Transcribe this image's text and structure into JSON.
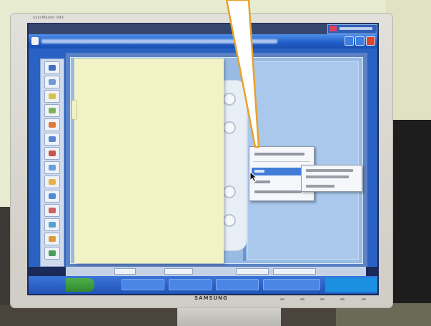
{
  "monitor": {
    "brand": "SAMSUNG",
    "model": "SyncMaster 943"
  },
  "window": {
    "controls": [
      "minimize-icon",
      "maximize-icon",
      "close-icon"
    ]
  },
  "toolbar": {
    "icons": [
      "tool-icon",
      "tool-icon",
      "tool-icon",
      "tool-icon",
      "tool-icon",
      "tool-icon",
      "tool-icon",
      "tool-icon",
      "tool-icon",
      "tool-icon",
      "tool-icon",
      "tool-icon",
      "tool-icon",
      "tool-icon"
    ]
  },
  "colors": {
    "title_bar": "#1f5cc8",
    "page": "#f1f3c6",
    "menu_highlight": "#3f7dd8",
    "callout_border": "#e8a12a",
    "close_button": "#d9472f"
  }
}
